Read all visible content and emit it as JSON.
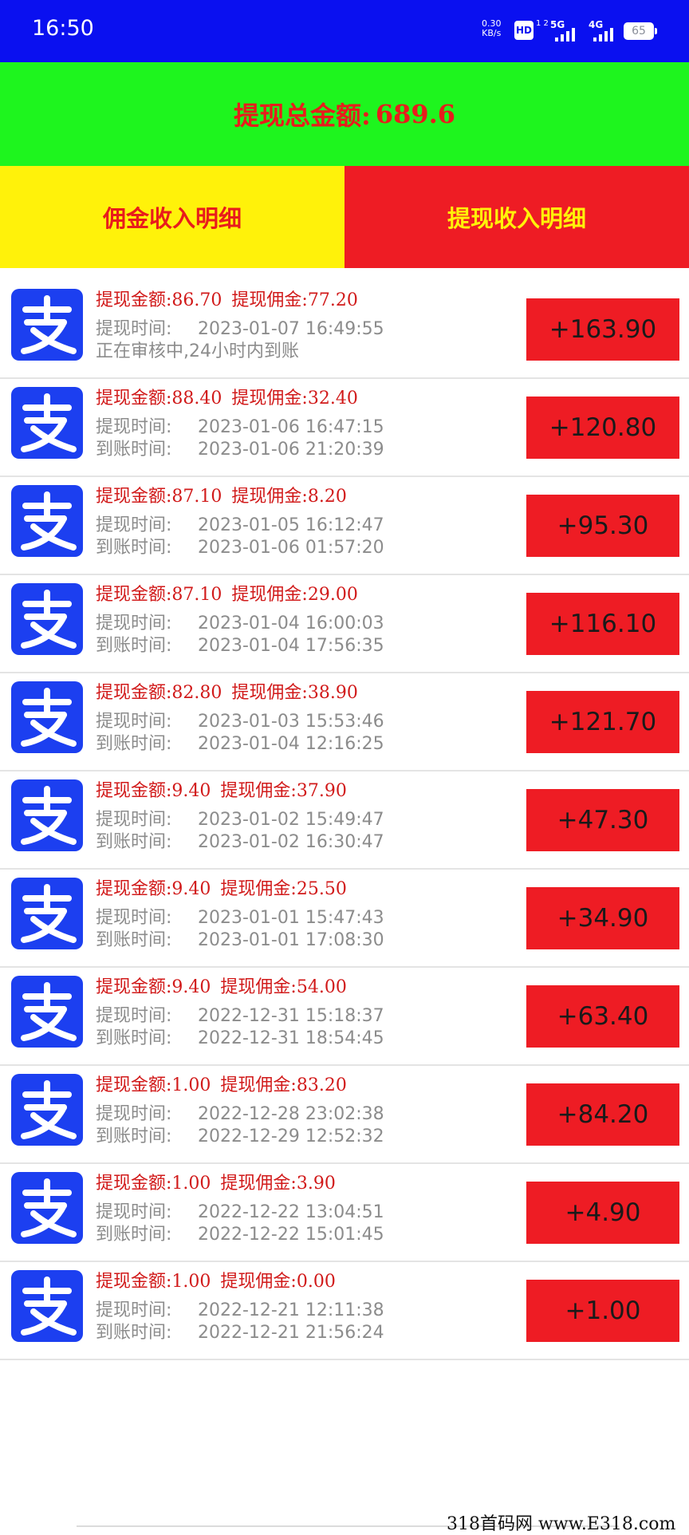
{
  "status_bar": {
    "time": "16:50",
    "net_speed_value": "0.30",
    "net_speed_unit": "KB/s",
    "hd_label": "HD",
    "hd_sub": "1 2",
    "net1": "5G",
    "net2": "4G",
    "battery": "65"
  },
  "total": {
    "label": "提现总金额:",
    "value": "689.6"
  },
  "tabs": {
    "commission": "佣金收入明细",
    "withdraw": "提现收入明细"
  },
  "labels": {
    "amount": "提现金额:",
    "commission": "提现佣金:",
    "withdraw_time": "提现时间:",
    "arrive_time": "到账时间:"
  },
  "records": [
    {
      "amount": "86.70",
      "commission": "77.20",
      "withdraw_time": "2023-01-07 16:49:55",
      "status": "正在审核中,24小时内到账",
      "total": "+163.90"
    },
    {
      "amount": "88.40",
      "commission": "32.40",
      "withdraw_time": "2023-01-06 16:47:15",
      "arrive_time": "2023-01-06 21:20:39",
      "total": "+120.80"
    },
    {
      "amount": "87.10",
      "commission": "8.20",
      "withdraw_time": "2023-01-05 16:12:47",
      "arrive_time": "2023-01-06 01:57:20",
      "total": "+95.30"
    },
    {
      "amount": "87.10",
      "commission": "29.00",
      "withdraw_time": "2023-01-04 16:00:03",
      "arrive_time": "2023-01-04 17:56:35",
      "total": "+116.10"
    },
    {
      "amount": "82.80",
      "commission": "38.90",
      "withdraw_time": "2023-01-03 15:53:46",
      "arrive_time": "2023-01-04 12:16:25",
      "total": "+121.70"
    },
    {
      "amount": "9.40",
      "commission": "37.90",
      "withdraw_time": "2023-01-02 15:49:47",
      "arrive_time": "2023-01-02 16:30:47",
      "total": "+47.30"
    },
    {
      "amount": "9.40",
      "commission": "25.50",
      "withdraw_time": "2023-01-01 15:47:43",
      "arrive_time": "2023-01-01 17:08:30",
      "total": "+34.90"
    },
    {
      "amount": "9.40",
      "commission": "54.00",
      "withdraw_time": "2022-12-31 15:18:37",
      "arrive_time": "2022-12-31 18:54:45",
      "total": "+63.40"
    },
    {
      "amount": "1.00",
      "commission": "83.20",
      "withdraw_time": "2022-12-28 23:02:38",
      "arrive_time": "2022-12-29 12:52:32",
      "total": "+84.20"
    },
    {
      "amount": "1.00",
      "commission": "3.90",
      "withdraw_time": "2022-12-22 13:04:51",
      "arrive_time": "2022-12-22 15:01:45",
      "total": "+4.90"
    },
    {
      "amount": "1.00",
      "commission": "0.00",
      "withdraw_time": "2022-12-21 12:11:38",
      "arrive_time": "2022-12-21 21:56:24",
      "total": "+1.00"
    }
  ],
  "icon_name": "alipay-icon",
  "colors": {
    "status_bar": "#0a10f0",
    "total_bg": "#1ef51e",
    "tab_commission_bg": "#fff20a",
    "tab_withdraw_bg": "#ee1c24",
    "accent_red": "#e81c1c",
    "alipay_blue": "#1c3ff0"
  },
  "watermark": "318首码网 www.E318.com"
}
